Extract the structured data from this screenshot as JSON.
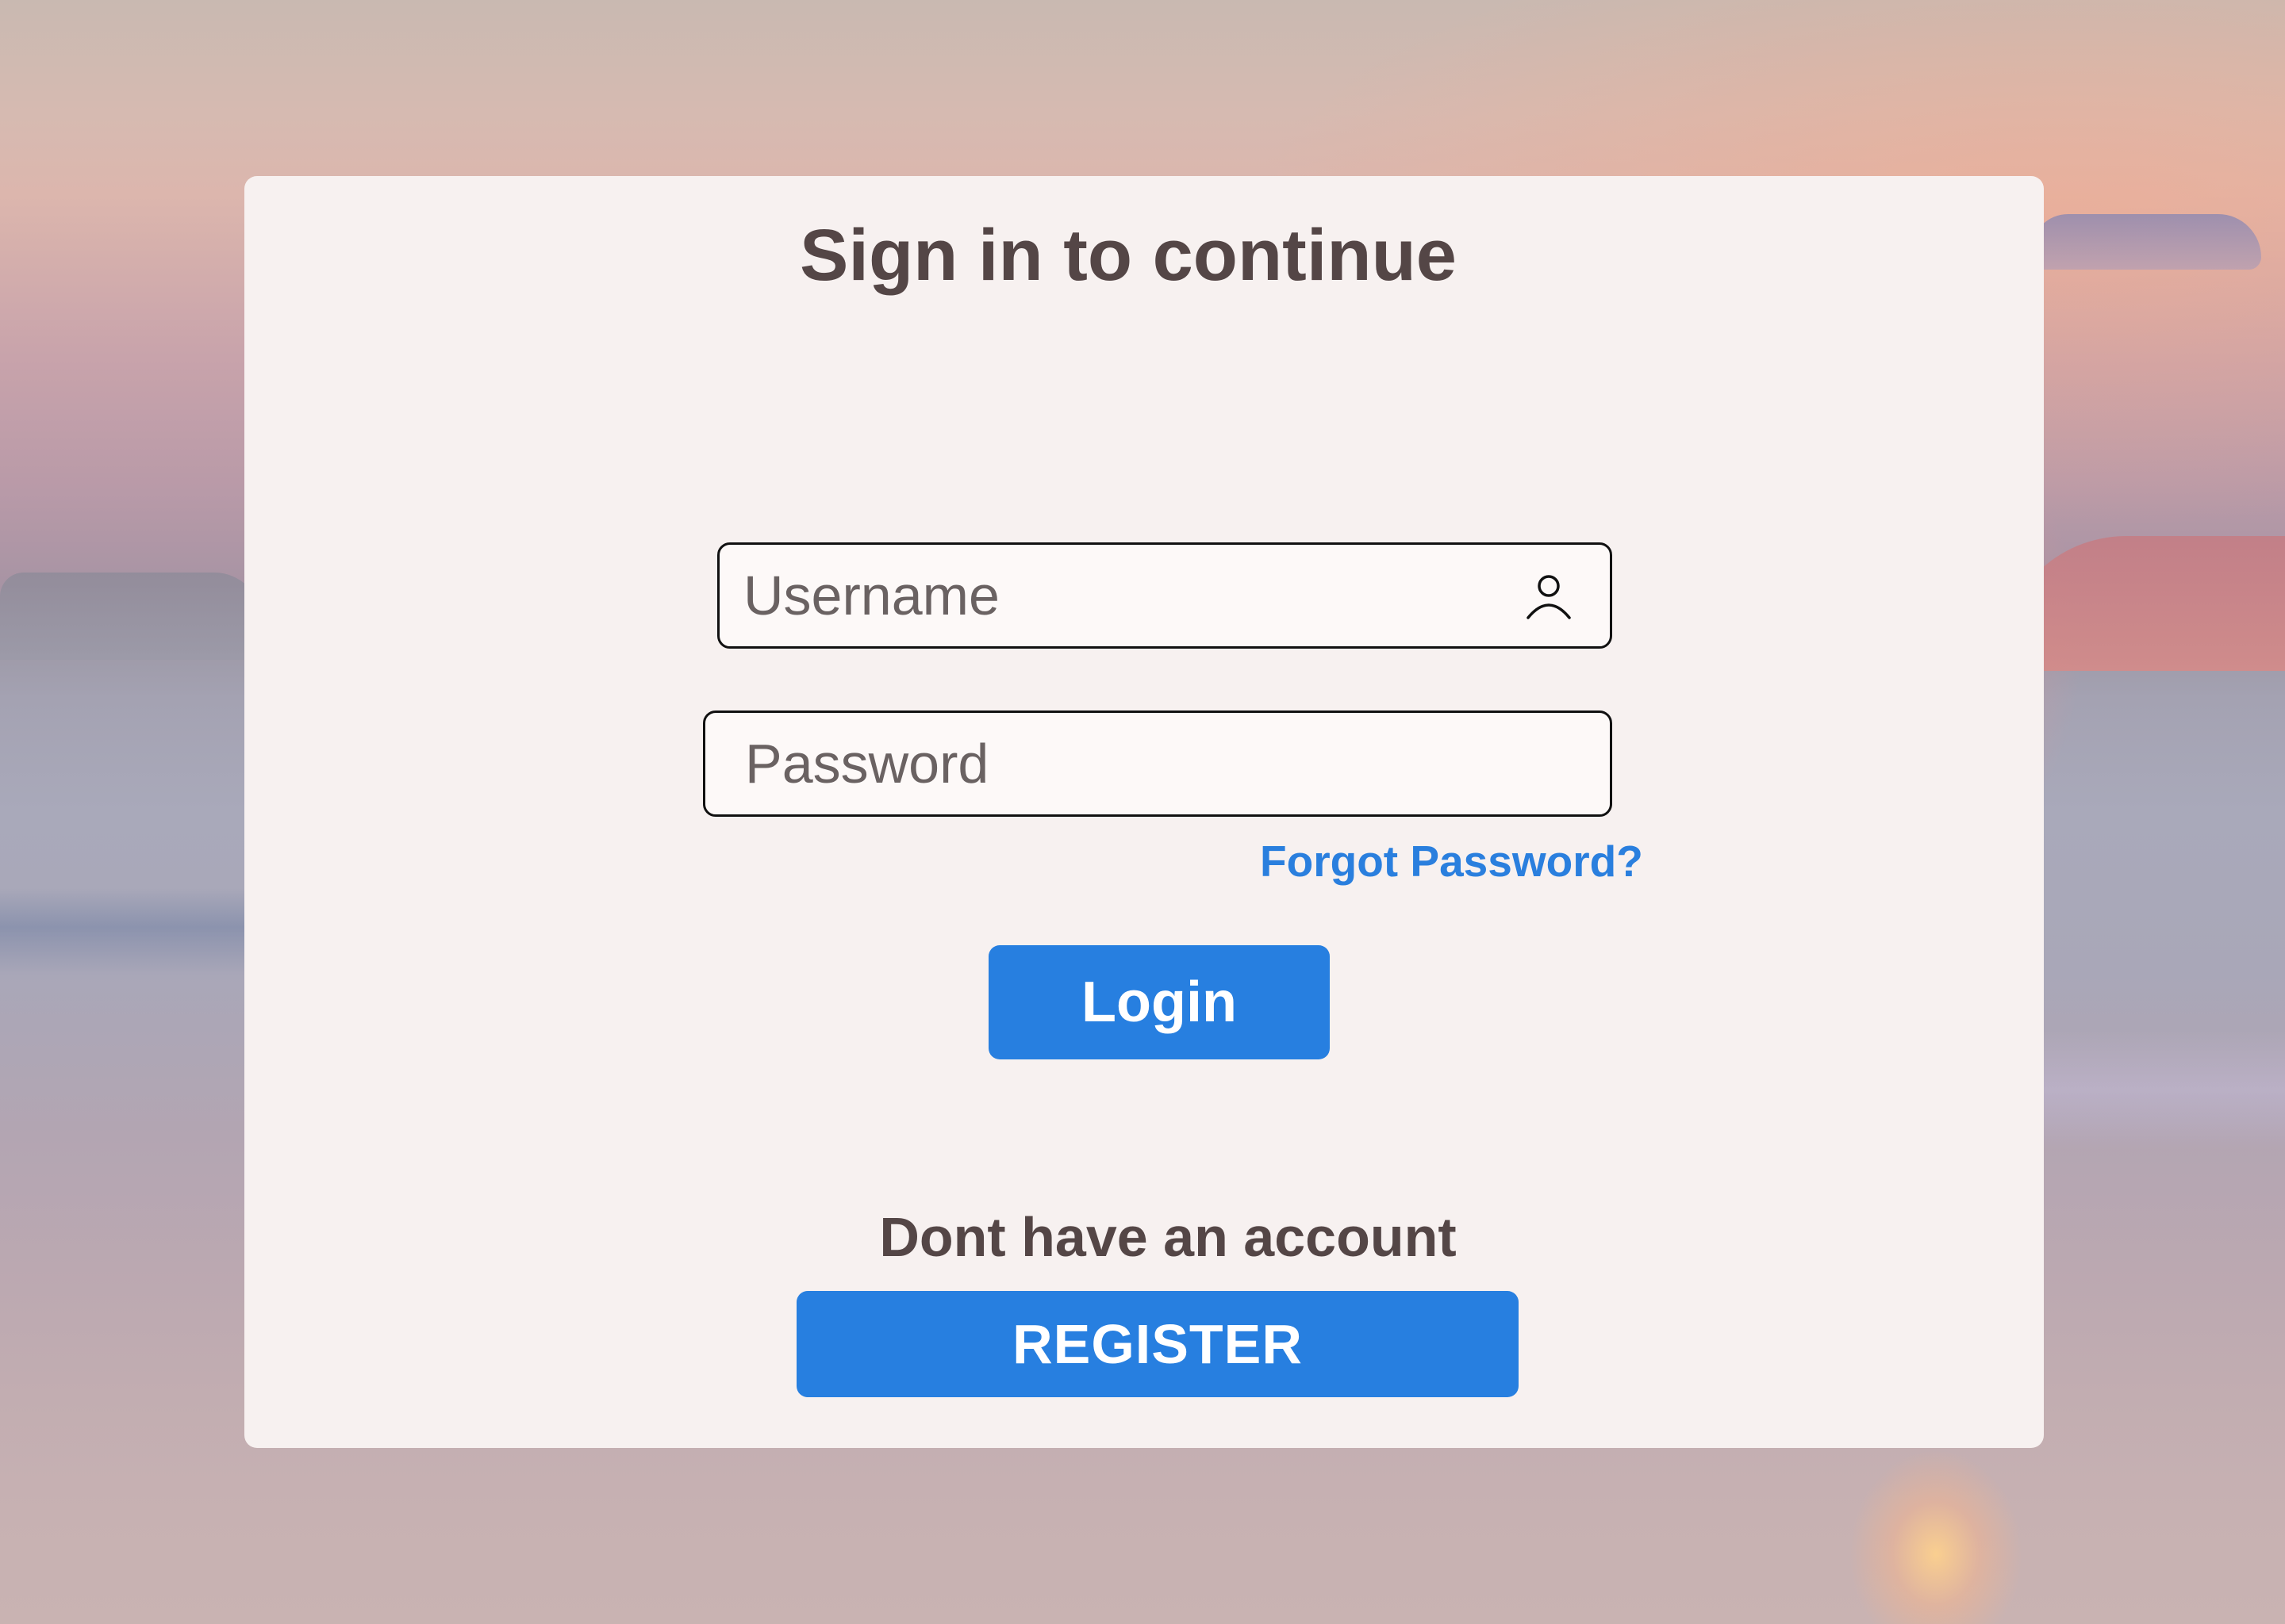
{
  "page": {
    "title": "Sign in to continue"
  },
  "form": {
    "username": {
      "placeholder": "Username",
      "value": "",
      "icon": "user-icon"
    },
    "password": {
      "placeholder": "Password",
      "value": ""
    },
    "forgot_password_label": "Forgot Password?",
    "login_label": "Login"
  },
  "register": {
    "prompt": "Dont have an account",
    "button_label": "REGISTER"
  },
  "colors": {
    "accent": "#277fe0",
    "link": "#2a7fde",
    "card_background": "#f7f1f0",
    "text": "#544646"
  }
}
